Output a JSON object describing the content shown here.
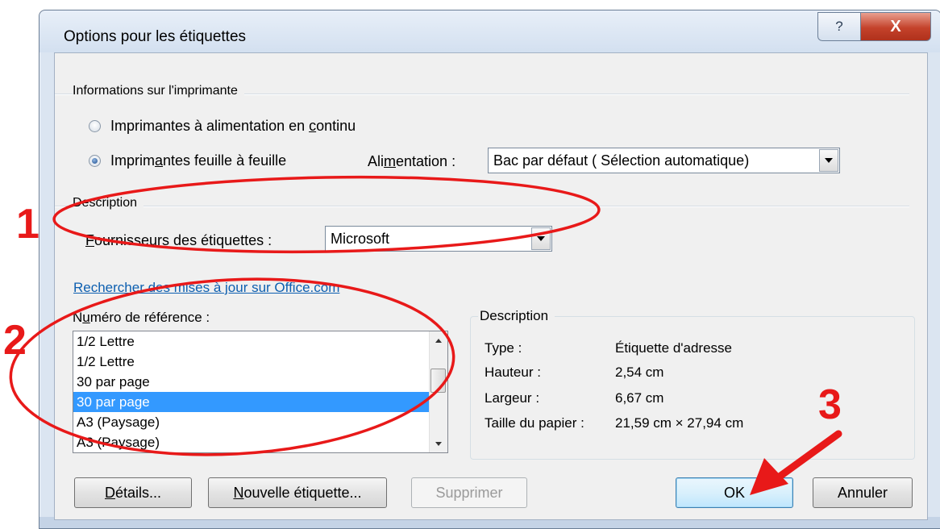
{
  "window": {
    "title": "Options pour les étiquettes",
    "help_icon": "help-icon",
    "close_icon": "close-icon",
    "help_glyph": "?",
    "close_glyph": "X"
  },
  "printer_info": {
    "group_title": "Informations sur l'imprimante",
    "radio_continuous": {
      "pre": "Imprimantes à alimentation en ",
      "ul": "c",
      "post": "ontinu",
      "checked": false
    },
    "radio_sheet": {
      "pre": "Imprim",
      "ul": "a",
      "post": "ntes feuille à feuille",
      "checked": true
    },
    "tray_label": {
      "pre": "Ali",
      "ul": "m",
      "post": "entation :"
    },
    "tray_value": "Bac par défaut ( Sélection automatique)"
  },
  "description_section": {
    "group_title": "Description",
    "vendor_label": {
      "pre": "",
      "ul": "F",
      "post": "ournisseurs des étiquettes :"
    },
    "vendor_value": "Microsoft"
  },
  "update_link": "Rechercher des mises à jour sur Office.com",
  "product": {
    "label": {
      "pre": "N",
      "ul": "u",
      "post": "méro de référence :"
    },
    "items": [
      {
        "text": "1/2 Lettre",
        "selected": false
      },
      {
        "text": "1/2 Lettre",
        "selected": false
      },
      {
        "text": "30 par page",
        "selected": false
      },
      {
        "text": "30 par page",
        "selected": true
      },
      {
        "text": "A3 (Paysage)",
        "selected": false
      },
      {
        "text": "A3 (Paysage)",
        "selected": false
      }
    ]
  },
  "details_box": {
    "title": "Description",
    "rows": [
      {
        "key": "Type :",
        "value": "Étiquette d'adresse"
      },
      {
        "key": "Hauteur :",
        "value": "2,54 cm"
      },
      {
        "key": "Largeur :",
        "value": "6,67 cm"
      },
      {
        "key": "Taille du papier :",
        "value": "21,59 cm × 27,94 cm"
      }
    ]
  },
  "buttons": {
    "details": {
      "pre": "",
      "ul": "D",
      "post": "étails..."
    },
    "new_label": {
      "pre": "",
      "ul": "N",
      "post": "ouvelle étiquette..."
    },
    "delete": "Supprimer",
    "ok": "OK",
    "cancel": "Annuler"
  },
  "annotations": {
    "marker_1": "1",
    "marker_2": "2",
    "marker_3": "3",
    "color": "#e81919"
  },
  "colors": {
    "link": "#0d5fb0",
    "selection": "#3399ff",
    "close_button": "#c4422b"
  }
}
